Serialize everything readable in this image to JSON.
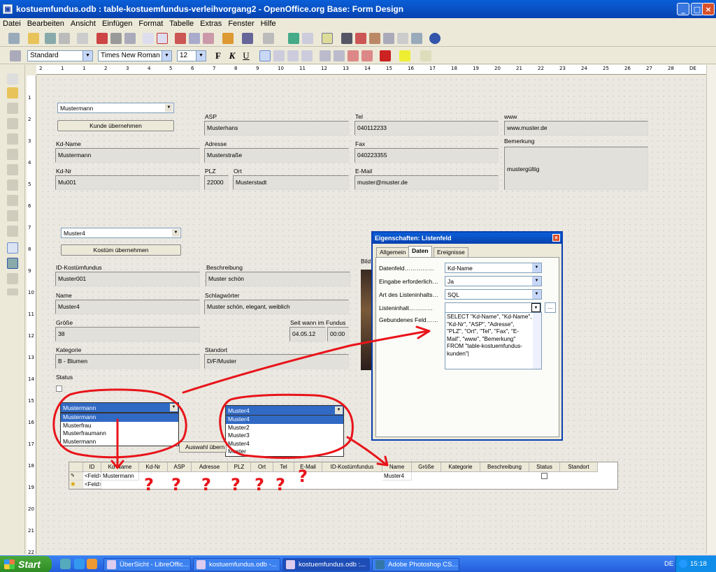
{
  "window": {
    "title": "kostuemfundus.odb : table-kostuemfundus-verleihvorgang2 - OpenOffice.org Base: Form Design",
    "minimize": "_",
    "maximize": "□",
    "close": "×"
  },
  "menu": [
    "Datei",
    "Bearbeiten",
    "Ansicht",
    "Einfügen",
    "Format",
    "Tabelle",
    "Extras",
    "Fenster",
    "Hilfe"
  ],
  "format_toolbar": {
    "style": "Standard",
    "font": "Times New Roman",
    "size": "12",
    "bold": "F",
    "italic": "K",
    "underline": "U"
  },
  "ruler": {
    "h": [
      "2",
      "1",
      "1",
      "2",
      "3",
      "4",
      "5",
      "6",
      "7",
      "8",
      "9",
      "10",
      "11",
      "12",
      "13",
      "14",
      "15",
      "16",
      "17",
      "18",
      "19",
      "20",
      "21",
      "22",
      "23",
      "24",
      "25",
      "26",
      "27",
      "28",
      "DE"
    ],
    "v": [
      "1",
      "2",
      "3",
      "4",
      "5",
      "6",
      "7",
      "8",
      "9",
      "10",
      "11",
      "12",
      "13",
      "14",
      "15",
      "16",
      "17",
      "18",
      "19",
      "20",
      "21",
      "22"
    ]
  },
  "kunde": {
    "select": "Mustermann",
    "button": "Kunde übernehmen",
    "fields": [
      {
        "label": "ASP",
        "value": "Musterhans"
      },
      {
        "label": "Tel",
        "value": "040112233"
      },
      {
        "label": "www",
        "value": "www.muster.de"
      },
      {
        "label": "Kd-Name",
        "value": "Mustermann"
      },
      {
        "label": "Adresse",
        "value": "Musterstraße"
      },
      {
        "label": "Fax",
        "value": "040223355"
      },
      {
        "label": "Bemerkung",
        "value": "mustergültig"
      },
      {
        "label": "Kd-Nr",
        "value": "Mu001"
      },
      {
        "label": "PLZ",
        "value": "22000"
      },
      {
        "label": "Ort",
        "value": "Musterstadt"
      },
      {
        "label": "E-Mail",
        "value": "muster@muster.de"
      }
    ]
  },
  "kostuem": {
    "select": "Muster4",
    "button": "Kostüm übernehmen",
    "fields": [
      {
        "label": "ID-Kostümfundus",
        "value": "Muster001"
      },
      {
        "label": "Beschreibung",
        "value": "Muster schön"
      },
      {
        "label": "Name",
        "value": "Muster4"
      },
      {
        "label": "Schlagwörter",
        "value": "Muster schön, elegant, weiblich"
      },
      {
        "label": "Größe",
        "value": "38"
      },
      {
        "label": "Seit wann im Fundus",
        "value": "04.05.12",
        "value2": "00:00"
      },
      {
        "label": "Kategorie",
        "value": "B - Blumen"
      },
      {
        "label": "Standort",
        "value": "D/F/Muster"
      }
    ],
    "bild_label": "Bild",
    "status_label": "Status"
  },
  "list_kunde": {
    "selected": "Mustermann",
    "items": [
      "Mustermann",
      "Musterfrau",
      "Musterfraumann",
      "Mustermann"
    ]
  },
  "list_kostuem": {
    "selected": "Muster4",
    "items": [
      "Muster4",
      "Muster2",
      "Muster3",
      "Muster4",
      "Muster"
    ]
  },
  "auswahl_button": "Auswahl übern",
  "grid": {
    "columns": [
      "ID",
      "Kd-Name",
      "Kd-Nr",
      "ASP",
      "Adresse",
      "PLZ",
      "Ort",
      "Tel",
      "E-Mail",
      "ID-Kostümfundus",
      "Name",
      "Größe",
      "Kategorie",
      "Beschreibung",
      "Status",
      "Standort"
    ],
    "rows": [
      {
        "id": "<Feld>",
        "kd_name": "Mustermann",
        "name": "Muster4"
      },
      {
        "id": "<Feld>"
      }
    ]
  },
  "dialog": {
    "title": "Eigenschaften: Listenfeld",
    "tabs": [
      "Allgemein",
      "Daten",
      "Ereignisse"
    ],
    "rows": [
      {
        "label": "Datenfeld……………",
        "value": "Kd-Name"
      },
      {
        "label": "Eingabe erforderlich…",
        "value": "Ja"
      },
      {
        "label": "Art des Listeninhalts…",
        "value": "SQL"
      },
      {
        "label": "Listeninhalt…………",
        "value": ""
      },
      {
        "label": "Gebundenes Feld……",
        "value": ""
      }
    ],
    "sql": "SELECT \"Kd-Name\", \"Kd-Name\",\n\"Kd-Nr\", \"ASP\", \"Adresse\",\n\"PLZ\", \"Ort\", \"Tel\", \"Fax\", \"E-\nMail\", \"www\", \"Bemerkung\"\nFROM \"table-kostuemfundus-\nkunden\"|",
    "browse": "..."
  },
  "taskbar": {
    "start": "Start",
    "tasks": [
      "ÜberSicht - LibreOffic...",
      "kostuemfundus.odb -...",
      "kostuemfundus.odb :...",
      "Adobe Photoshop CS..."
    ],
    "lang": "DE",
    "clock": "15:18"
  },
  "annotation": {
    "color": "#e8141a",
    "marks": "? ? ? ? ? ? ?"
  }
}
